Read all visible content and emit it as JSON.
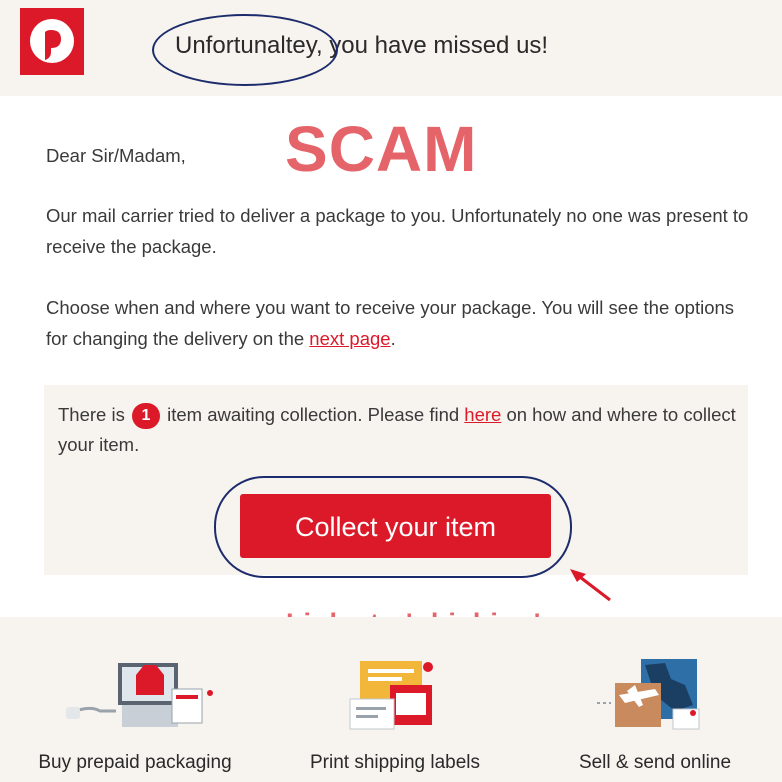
{
  "header": {
    "title": "Unfortunaltey, you have missed us!"
  },
  "scam_label": "SCAM",
  "greeting": "Dear Sir/Madam,",
  "paragraph1": "Our mail carrier tried to deliver a package to you. Unfortunately no one was present to receive the package.",
  "paragraph2": {
    "before": "Choose when and where you want to receive your package. You will see the options for changing the delivery on the ",
    "link": "next page",
    "after": "."
  },
  "panel": {
    "text_before": "There is ",
    "badge_count": "1",
    "text_middle": " item awaiting collection. Please find ",
    "link": "here",
    "text_after": " on how and where to collect your item."
  },
  "cta_label": "Collect your item",
  "annotation": "Links to 'phishing' survey",
  "footer": [
    {
      "label": "Buy prepaid packaging",
      "icon": "packaging-icon"
    },
    {
      "label": "Print shipping labels",
      "icon": "labels-icon"
    },
    {
      "label": "Sell & send online",
      "icon": "sell-send-icon"
    }
  ],
  "colors": {
    "brand_red": "#dc1928",
    "annotation_pink": "#e4646a",
    "ellipse_navy": "#1c2b6b",
    "panel_beige": "#f7f3ef"
  }
}
